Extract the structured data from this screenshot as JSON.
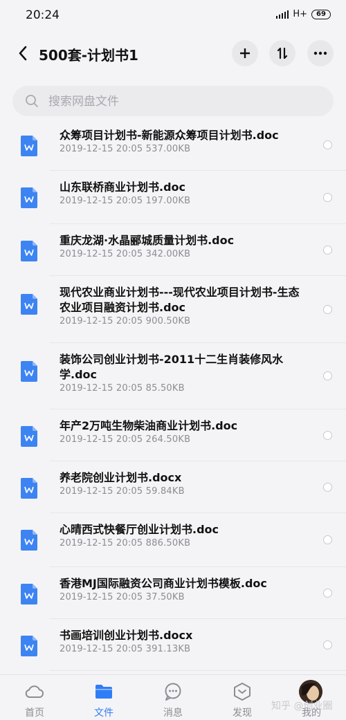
{
  "status_bar": {
    "time": "20:24",
    "network": "H+",
    "battery": "69"
  },
  "header": {
    "title": "500套-计划书1"
  },
  "search": {
    "placeholder": "搜索网盘文件",
    "value": ""
  },
  "files": [
    {
      "name": "众筹项目计划书-新能源众筹项目计划书.doc",
      "meta": "2019-12-15  20:05  537.00KB"
    },
    {
      "name": "山东联桥商业计划书.doc",
      "meta": "2019-12-15  20:05  197.00KB"
    },
    {
      "name": "重庆龙湖·水晶郦城质量计划书.doc",
      "meta": "2019-12-15  20:05  342.00KB"
    },
    {
      "name": "现代农业商业计划书---现代农业项目计划书-生态农业项目融资计划书.doc",
      "meta": "2019-12-15  20:05  900.50KB"
    },
    {
      "name": "装饰公司创业计划书-2011十二生肖装修风水学.doc",
      "meta": "2019-12-15  20:05  85.50KB"
    },
    {
      "name": "年产2万吨生物柴油商业计划书.doc",
      "meta": "2019-12-15  20:05  264.50KB"
    },
    {
      "name": "养老院创业计划书.docx",
      "meta": "2019-12-15  20:05  59.84KB"
    },
    {
      "name": "心晴西式快餐厅创业计划书.doc",
      "meta": "2019-12-15  20:05  886.50KB"
    },
    {
      "name": "香港MJ国际融资公司商业计划书模板.doc",
      "meta": "2019-12-15  20:05  37.50KB"
    },
    {
      "name": "书画培训创业计划书.docx",
      "meta": "2019-12-15  20:05  391.13KB"
    }
  ],
  "tabs": [
    {
      "label": "首页",
      "icon": "cloud-icon"
    },
    {
      "label": "文件",
      "icon": "folder-icon",
      "active": true
    },
    {
      "label": "消息",
      "icon": "chat-icon"
    },
    {
      "label": "发现",
      "icon": "discover-icon"
    },
    {
      "label": "我的",
      "icon": "avatar"
    }
  ],
  "watermark": "知乎 @创业圈",
  "colors": {
    "accent": "#2f7df6",
    "doc_icon": "#3d84f2"
  }
}
